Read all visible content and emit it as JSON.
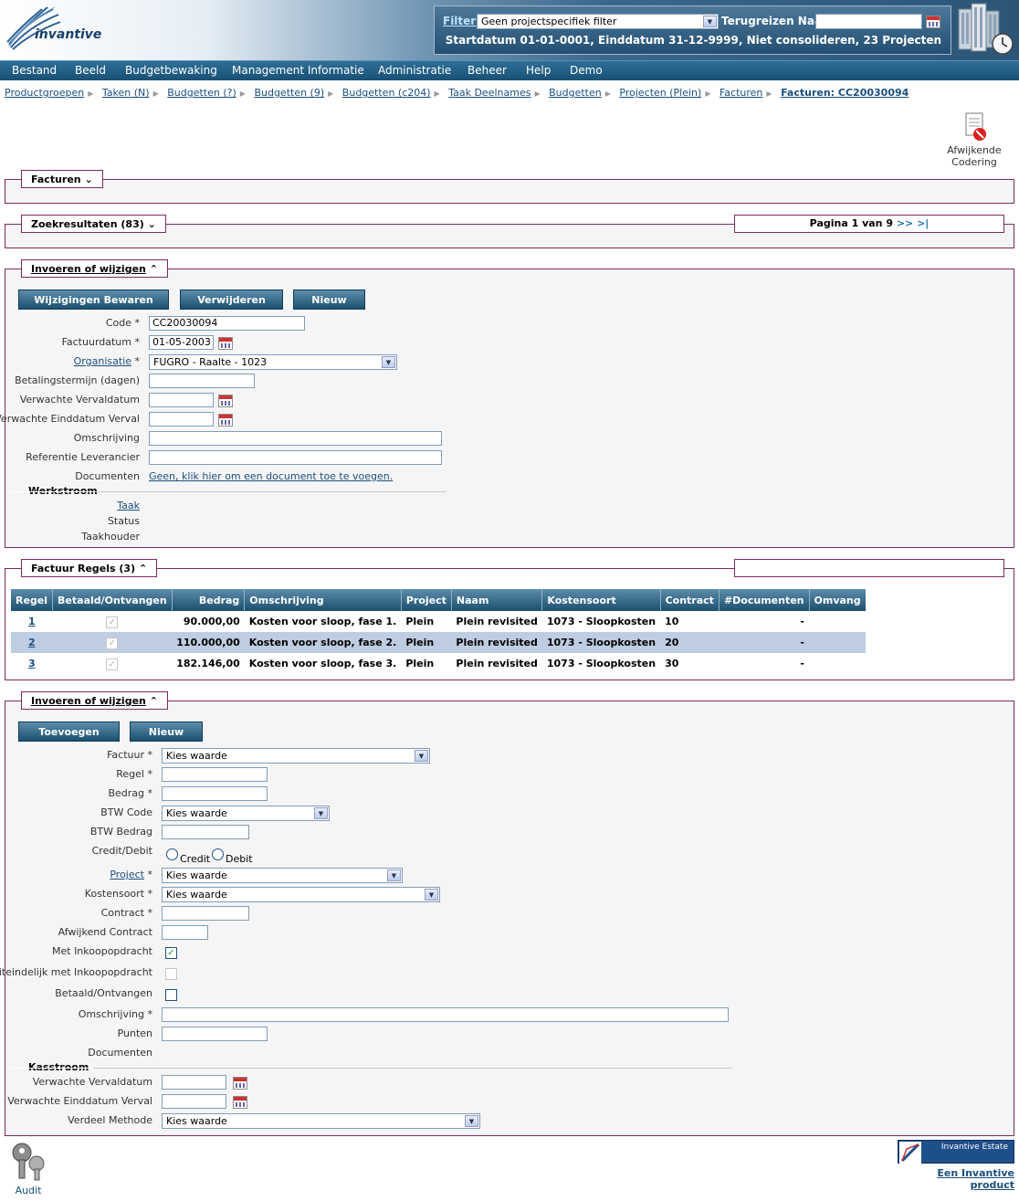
{
  "header": {
    "brand": "invantive",
    "filter_label": "Filter:",
    "filter_value": "Geen projectspecifiek filter",
    "terugreizen_label": "Terugreizen Naar:",
    "terugreizen_value": "",
    "summary": "Startdatum 01-01-0001, Einddatum 31-12-9999, Niet consolideren, 23 Projecten"
  },
  "menu": [
    "Bestand",
    "Beeld",
    "Budgetbewaking",
    "Management Informatie",
    "Administratie",
    "Beheer",
    "Help",
    "Demo"
  ],
  "breadcrumbs": [
    "Productgroepen",
    "Taken (N)",
    "Budgetten (?)",
    "Budgetten (9)",
    "Budgetten (c204)",
    "Taak Deelnames",
    "Budgetten",
    "Projecten (Plein)",
    "Facturen"
  ],
  "breadcrumb_current": "Facturen: CC20030094",
  "toolbar": {
    "afwijkende_label_1": "Afwijkende",
    "afwijkende_label_2": "Codering"
  },
  "panels": {
    "facturen": "Facturen",
    "zoekresultaten": "Zoekresultaten (83)",
    "pagina": "Pagina 1 van 9",
    "pagina_nav": ">> >|",
    "invoeren": "Invoeren of wijzigen",
    "factuur_regels": "Factuur Regels (3)",
    "invoeren2": "Invoeren of wijzigen"
  },
  "form1": {
    "buttons": {
      "save": "Wijzigingen Bewaren",
      "delete": "Verwijderen",
      "new": "Nieuw"
    },
    "labels": {
      "code": "Code *",
      "factuurdatum": "Factuurdatum *",
      "organisatie": "Organisatie",
      "organisatie_req": "*",
      "betalingstermijn": "Betalingstermijn (dagen)",
      "verwachte_vervaldatum": "Verwachte Vervaldatum",
      "verwachte_einddatum": "Verwachte Einddatum Verval",
      "omschrijving": "Omschrijving",
      "referentie": "Referentie Leverancier",
      "documenten": "Documenten",
      "werkstroom": "Werkstroom",
      "taak": "Taak",
      "status": "Status",
      "taakhouder": "Taakhouder"
    },
    "values": {
      "code": "CC20030094",
      "factuurdatum": "01-05-2003",
      "organisatie": "FUGRO - Raalte - 1023",
      "betalingstermijn": "",
      "verwachte_vervaldatum": "",
      "verwachte_einddatum": "",
      "omschrijving": "",
      "referentie": "",
      "documenten_link": "Geen, klik hier om een document toe te voegen."
    }
  },
  "grid": {
    "headers": [
      "Regel",
      "Betaald/Ontvangen",
      "Bedrag",
      "Omschrijving",
      "Project",
      "Naam",
      "Kostensoort",
      "Contract",
      "#Documenten",
      "Omvang"
    ],
    "rows": [
      {
        "regel": "1",
        "bedrag": "90.000,00",
        "omschrijving": "Kosten voor sloop, fase 1.",
        "project": "Plein",
        "naam": "Plein revisited",
        "kostensoort": "1073 - Sloopkosten",
        "contract": "10",
        "documenten": "-",
        "omvang": ""
      },
      {
        "regel": "2",
        "bedrag": "110.000,00",
        "omschrijving": "Kosten voor sloop, fase 2.",
        "project": "Plein",
        "naam": "Plein revisited",
        "kostensoort": "1073 - Sloopkosten",
        "contract": "20",
        "documenten": "-",
        "omvang": ""
      },
      {
        "regel": "3",
        "bedrag": "182.146,00",
        "omschrijving": "Kosten voor sloop, fase 3.",
        "project": "Plein",
        "naam": "Plein revisited",
        "kostensoort": "1073 - Sloopkosten",
        "contract": "30",
        "documenten": "-",
        "omvang": ""
      }
    ]
  },
  "form2": {
    "buttons": {
      "add": "Toevoegen",
      "new": "Nieuw"
    },
    "labels": {
      "factuur": "Factuur *",
      "regel": "Regel *",
      "bedrag": "Bedrag *",
      "btw_code": "BTW Code",
      "btw_bedrag": "BTW Bedrag",
      "credit_debit": "Credit/Debit",
      "credit": "Credit",
      "debit": "Debit",
      "project": "Project",
      "project_req": "*",
      "kostensoort": "Kostensoort *",
      "contract": "Contract *",
      "afwijkend_contract": "Afwijkend Contract",
      "met_inkoopopdracht": "Met Inkoopopdracht",
      "uiteindelijk": "Uiteindelijk met Inkoopopdracht",
      "betaald": "Betaald/Ontvangen",
      "omschrijving": "Omschrijving *",
      "punten": "Punten",
      "documenten": "Documenten",
      "kasstroom": "Kasstroom",
      "verwachte_vervaldatum": "Verwachte Vervaldatum",
      "verwachte_einddatum": "Verwachte Einddatum Verval",
      "verdeel_methode": "Verdeel Methode"
    },
    "values": {
      "factuur": "Kies waarde",
      "btw_code": "Kies waarde",
      "project": "Kies waarde",
      "kostensoort": "Kies waarde",
      "verdeel_methode": "Kies waarde"
    }
  },
  "footer": {
    "audit": "Audit",
    "product_link": "Een Invantive product",
    "product_logo": "Invantive Estate"
  }
}
